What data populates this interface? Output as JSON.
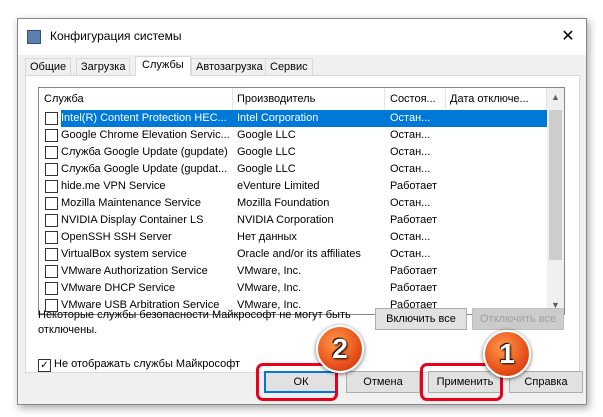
{
  "window": {
    "title": "Конфигурация системы"
  },
  "tabs": [
    {
      "label": "Общие"
    },
    {
      "label": "Загрузка"
    },
    {
      "label": "Службы"
    },
    {
      "label": "Автозагрузка"
    },
    {
      "label": "Сервис"
    }
  ],
  "columns": [
    "Служба",
    "Производитель",
    "Состоя...",
    "Дата отключе..."
  ],
  "rows": [
    {
      "name": "Intel(R) Content Protection HEC...",
      "vendor": "Intel Corporation",
      "status": "Остан...",
      "selected": true
    },
    {
      "name": "Google Chrome Elevation Servic...",
      "vendor": "Google LLC",
      "status": "Остан..."
    },
    {
      "name": "Служба Google Update (gupdate)",
      "vendor": "Google LLC",
      "status": "Остан..."
    },
    {
      "name": "Служба Google Update (gupdat...",
      "vendor": "Google LLC",
      "status": "Остан..."
    },
    {
      "name": "hide.me VPN Service",
      "vendor": "eVenture Limited",
      "status": "Работает"
    },
    {
      "name": "Mozilla Maintenance Service",
      "vendor": "Mozilla Foundation",
      "status": "Остан..."
    },
    {
      "name": "NVIDIA Display Container LS",
      "vendor": "NVIDIA Corporation",
      "status": "Работает"
    },
    {
      "name": "OpenSSH SSH Server",
      "vendor": "Нет данных",
      "status": "Остан..."
    },
    {
      "name": "VirtualBox system service",
      "vendor": "Oracle and/or its affiliates",
      "status": "Остан..."
    },
    {
      "name": "VMware Authorization Service",
      "vendor": "VMware, Inc.",
      "status": "Работает"
    },
    {
      "name": "VMware DHCP Service",
      "vendor": "VMware, Inc.",
      "status": "Работает"
    },
    {
      "name": "VMware USB Arbitration Service",
      "vendor": "VMware, Inc.",
      "status": "Работает"
    }
  ],
  "note": "Некоторые службы безопасности Майкрософт не могут быть отключены.",
  "enable_all": "Включить все",
  "disable_all": "Отключить все",
  "hide_ms": "Не отображать службы Майкрософт",
  "buttons": {
    "ok": "ОК",
    "cancel": "Отмена",
    "apply": "Применить",
    "help": "Справка"
  },
  "badges": {
    "one": "1",
    "two": "2"
  }
}
